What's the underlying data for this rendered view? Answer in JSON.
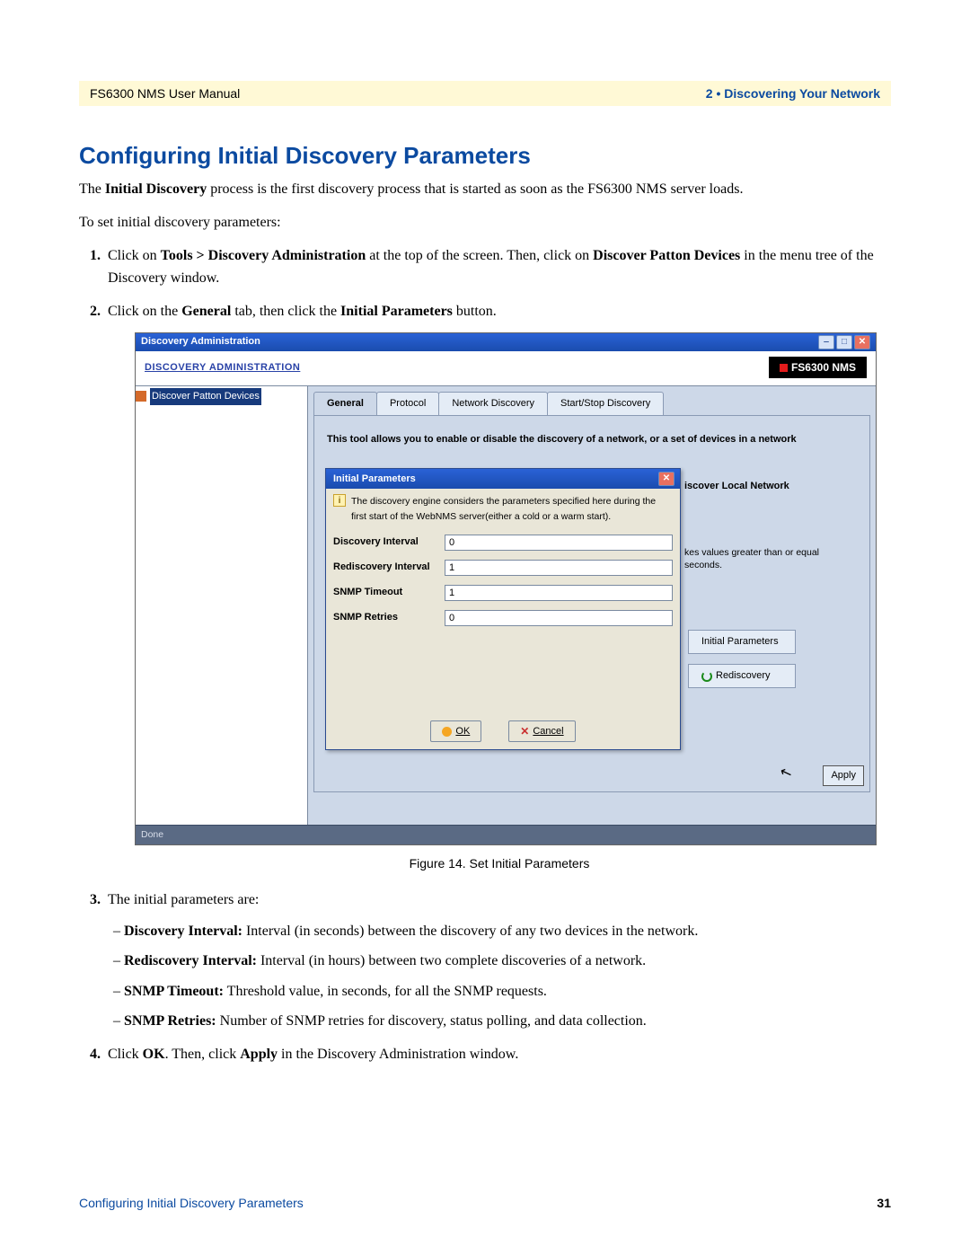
{
  "header": {
    "left": "FS6300 NMS User Manual",
    "right": "2 • Discovering Your Network"
  },
  "heading": "Configuring Initial Discovery Parameters",
  "intro": {
    "part1": "The ",
    "bold1": "Initial Discovery",
    "part2": " process is the first discovery process that is started as soon as the FS6300 NMS server loads."
  },
  "lead": "To set initial discovery parameters:",
  "step1": {
    "a": "Click on ",
    "b": "Tools > Discovery Administration",
    "c": " at the top of the screen. Then, click on ",
    "d": "Discover Patton Devices",
    "e": " in the menu tree of the Discovery window."
  },
  "step2": {
    "a": "Click on the ",
    "b": "General",
    "c": " tab, then click the ",
    "d": "Initial Parameters",
    "e": " button."
  },
  "app": {
    "window_title": "Discovery Administration",
    "admin_title": "DISCOVERY ADMINISTRATION",
    "product": "FS6300 NMS",
    "tree_item": "Discover Patton Devices",
    "tabs": [
      "General",
      "Protocol",
      "Network Discovery",
      "Start/Stop Discovery"
    ],
    "tool_desc": "This tool allows you to enable or disable the discovery of a network, or a set of devices in a network",
    "rt_label": "iscover Local Network",
    "rt_note1": "kes values greater than or equal",
    "rt_note2": "seconds.",
    "rt_btn1": "Initial Parameters",
    "rt_btn2": "Rediscovery",
    "apply": "Apply",
    "status": "Done"
  },
  "dialog": {
    "title": "Initial Parameters",
    "info": "The discovery engine considers the parameters specified here during the first start of  the WebNMS server(either a cold or a warm start).",
    "rows": [
      {
        "label": "Discovery Interval",
        "value": "0"
      },
      {
        "label": "Rediscovery Interval",
        "value": "1"
      },
      {
        "label": "SNMP Timeout",
        "value": "1"
      },
      {
        "label": "SNMP Retries",
        "value": "0"
      }
    ],
    "ok": "OK",
    "cancel": "Cancel"
  },
  "figure_caption": "Figure 14.  Set Initial Parameters",
  "step3_lead": "The initial parameters are:",
  "step3_items": [
    {
      "b": "Discovery Interval:",
      "t": " Interval (in seconds) between the discovery of any two devices in the network."
    },
    {
      "b": "Rediscovery Interval:",
      "t": " Interval (in hours) between two complete discoveries of a network."
    },
    {
      "b": "SNMP Timeout:",
      "t": " Threshold value, in seconds, for all the SNMP requests."
    },
    {
      "b": "SNMP Retries:",
      "t": " Number of SNMP retries for discovery, status polling, and data collection."
    }
  ],
  "step4": {
    "a": "Click ",
    "b": "OK",
    "c": ". Then, click ",
    "d": "Apply",
    "e": " in the Discovery Administration window."
  },
  "footer": {
    "left": "Configuring Initial Discovery Parameters",
    "right": "31"
  }
}
